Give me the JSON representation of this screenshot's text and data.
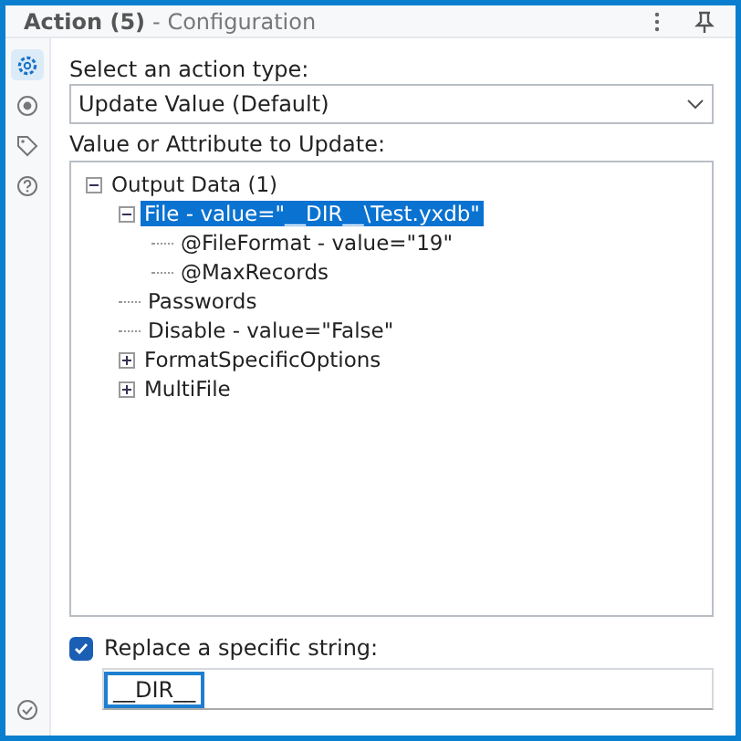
{
  "window": {
    "title": "Action (5)",
    "subtitle": "- Configuration"
  },
  "sidebar": {
    "items": [
      {
        "kind": "gear",
        "selected": true
      },
      {
        "kind": "circle",
        "selected": false
      },
      {
        "kind": "tag",
        "selected": false
      },
      {
        "kind": "help",
        "selected": false
      }
    ]
  },
  "action_type": {
    "label": "Select an action type:",
    "value": "Update Value (Default)"
  },
  "tree": {
    "label": "Value or Attribute to Update:",
    "items": [
      {
        "text": "Output Data (1)",
        "expanded": true,
        "selected": false,
        "children": [
          {
            "text": "File - value=\"__DIR__\\Test.yxdb\"",
            "expanded": true,
            "selected": true,
            "children": [
              {
                "text": "@FileFormat - value=\"19\"",
                "selected": false
              },
              {
                "text": "@MaxRecords",
                "selected": false
              }
            ]
          },
          {
            "text": "Passwords",
            "selected": false
          },
          {
            "text": "Disable - value=\"False\"",
            "selected": false
          },
          {
            "text": "FormatSpecificOptions",
            "expanded": false,
            "selected": false
          },
          {
            "text": "MultiFile",
            "expanded": false,
            "selected": false
          }
        ]
      }
    ]
  },
  "replace": {
    "label": "Replace a specific string:",
    "checked": true,
    "value": "__DIR__"
  }
}
